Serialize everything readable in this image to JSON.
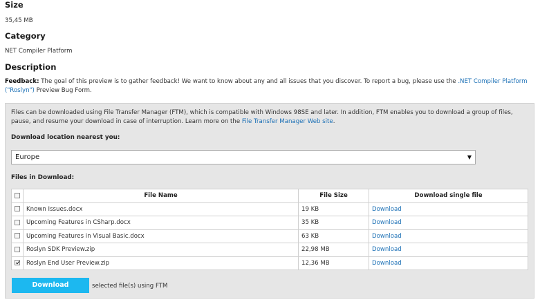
{
  "details": {
    "size_heading": "Size",
    "size_value": "35,45 MB",
    "category_heading": "Category",
    "category_value": "NET Compiler Platform",
    "description_heading": "Description"
  },
  "feedback": {
    "label": "Feedback:",
    "text_before": " The goal of this preview is to gather feedback! We want to know about any and all issues that you discover. To report a bug, please use the ",
    "link_text": ".NET Compiler Platform (\"Roslyn\")",
    "text_after": " Preview Bug Form."
  },
  "download_box": {
    "intro_before": "Files can be downloaded using File Transfer Manager (FTM), which is compatible with Windows 98SE and later. In addition, FTM enables you to download a group of files, pause, and resume your download in case of interruption. Learn more on the ",
    "intro_link": "File Transfer Manager Web site",
    "intro_after": ".",
    "location_label": "Download location nearest you:",
    "location_selected": "Europe",
    "files_label": "Files in Download:",
    "columns": {
      "name": "File Name",
      "size": "File Size",
      "single": "Download single file"
    },
    "rows": [
      {
        "name": "Known Issues.docx",
        "size": "19 KB",
        "link": "Download",
        "checked": false
      },
      {
        "name": "Upcoming Features in CSharp.docx",
        "size": "35 KB",
        "link": "Download",
        "checked": false
      },
      {
        "name": "Upcoming Features in Visual Basic.docx",
        "size": "63 KB",
        "link": "Download",
        "checked": false
      },
      {
        "name": "Roslyn SDK Preview.zip",
        "size": "22,98 MB",
        "link": "Download",
        "checked": false
      },
      {
        "name": "Roslyn End User Preview.zip",
        "size": "12,36 MB",
        "link": "Download",
        "checked": true
      }
    ],
    "download_button": "Download",
    "download_note": "selected file(s) using FTM"
  },
  "colors": {
    "link": "#1a6fb5",
    "button": "#1cb8f0",
    "box_background": "#e6e6e6"
  }
}
